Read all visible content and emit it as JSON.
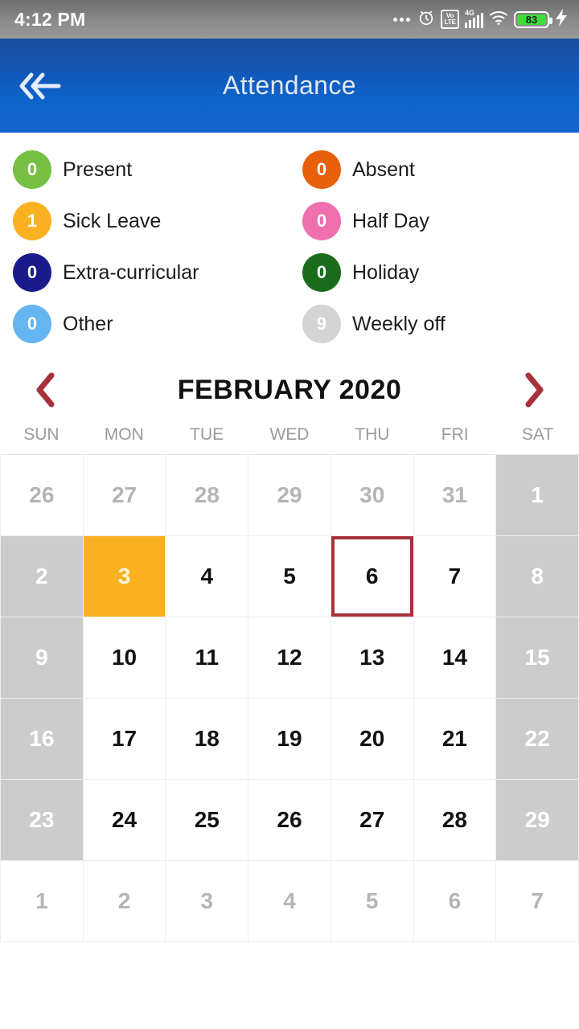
{
  "statusbar": {
    "time": "4:12 PM",
    "battery_percent": "83",
    "network_label": "4G",
    "volte_top": "Vo",
    "volte_bottom": "LTE",
    "icons": [
      "more-dots-icon",
      "alarm-icon",
      "volte-icon",
      "signal-icon",
      "wifi-icon",
      "battery-icon",
      "charging-bolt-icon"
    ]
  },
  "appbar": {
    "title": "Attendance",
    "back_label": "Back"
  },
  "legend": {
    "items": [
      {
        "count": "0",
        "label": "Present",
        "color": "#76c043"
      },
      {
        "count": "0",
        "label": "Absent",
        "color": "#e8600c"
      },
      {
        "count": "1",
        "label": "Sick Leave",
        "color": "#f9b122"
      },
      {
        "count": "0",
        "label": "Half Day",
        "color": "#f06faf"
      },
      {
        "count": "0",
        "label": "Extra-curricular",
        "color": "#1a1a8c"
      },
      {
        "count": "0",
        "label": "Holiday",
        "color": "#1a6b1a"
      },
      {
        "count": "0",
        "label": "Other",
        "color": "#64b5f0"
      },
      {
        "count": "9",
        "label": "Weekly off",
        "color": "#d4d4d4"
      }
    ]
  },
  "calendar": {
    "month_title": "FEBRUARY 2020",
    "prev_label": "Previous month",
    "next_label": "Next month",
    "weekdays": [
      "SUN",
      "MON",
      "TUE",
      "WED",
      "THU",
      "FRI",
      "SAT"
    ],
    "highlight_colors": {
      "sick_leave": "#f9b122",
      "weekly_off": "#cccccc",
      "today_outline": "#a8323c",
      "accent_arrow": "#a8323c"
    },
    "days": [
      {
        "n": "26",
        "state": "muted"
      },
      {
        "n": "27",
        "state": "muted"
      },
      {
        "n": "28",
        "state": "muted"
      },
      {
        "n": "29",
        "state": "muted"
      },
      {
        "n": "30",
        "state": "muted"
      },
      {
        "n": "31",
        "state": "muted"
      },
      {
        "n": "1",
        "state": "weekoff"
      },
      {
        "n": "2",
        "state": "weekoff"
      },
      {
        "n": "3",
        "state": "sick"
      },
      {
        "n": "4",
        "state": "normal"
      },
      {
        "n": "5",
        "state": "normal"
      },
      {
        "n": "6",
        "state": "today"
      },
      {
        "n": "7",
        "state": "normal"
      },
      {
        "n": "8",
        "state": "weekoff"
      },
      {
        "n": "9",
        "state": "weekoff"
      },
      {
        "n": "10",
        "state": "normal"
      },
      {
        "n": "11",
        "state": "normal"
      },
      {
        "n": "12",
        "state": "normal"
      },
      {
        "n": "13",
        "state": "normal"
      },
      {
        "n": "14",
        "state": "normal"
      },
      {
        "n": "15",
        "state": "weekoff"
      },
      {
        "n": "16",
        "state": "weekoff"
      },
      {
        "n": "17",
        "state": "normal"
      },
      {
        "n": "18",
        "state": "normal"
      },
      {
        "n": "19",
        "state": "normal"
      },
      {
        "n": "20",
        "state": "normal"
      },
      {
        "n": "21",
        "state": "normal"
      },
      {
        "n": "22",
        "state": "weekoff"
      },
      {
        "n": "23",
        "state": "weekoff"
      },
      {
        "n": "24",
        "state": "normal"
      },
      {
        "n": "25",
        "state": "normal"
      },
      {
        "n": "26",
        "state": "normal"
      },
      {
        "n": "27",
        "state": "normal"
      },
      {
        "n": "28",
        "state": "normal"
      },
      {
        "n": "29",
        "state": "weekoff"
      },
      {
        "n": "1",
        "state": "muted"
      },
      {
        "n": "2",
        "state": "muted"
      },
      {
        "n": "3",
        "state": "muted"
      },
      {
        "n": "4",
        "state": "muted"
      },
      {
        "n": "5",
        "state": "muted"
      },
      {
        "n": "6",
        "state": "muted"
      },
      {
        "n": "7",
        "state": "muted"
      }
    ]
  }
}
